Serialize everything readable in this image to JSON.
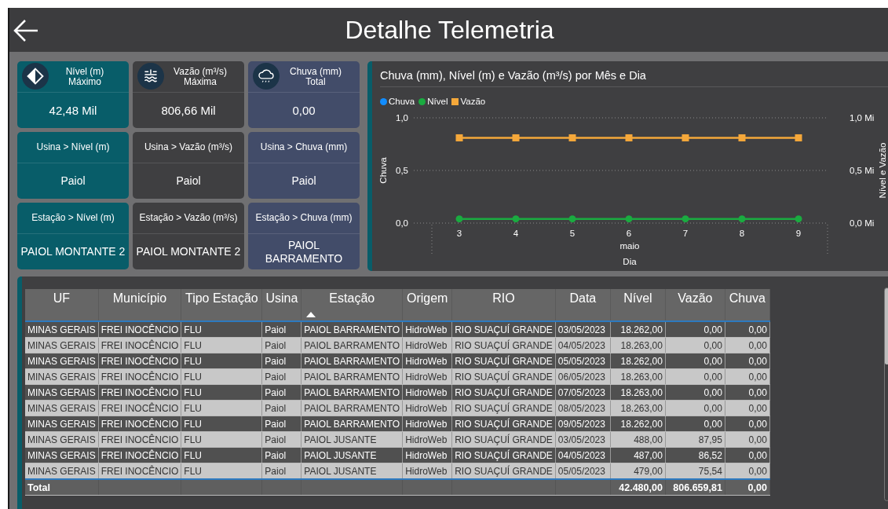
{
  "header": {
    "title": "Detalhe Telemetria"
  },
  "cards": [
    {
      "kind": "metric",
      "title": "Nível (m)",
      "subtitle": "Máximo",
      "value": "42,48 Mil",
      "color": "#085d69"
    },
    {
      "kind": "metric",
      "title": "Vazão (m³/s)",
      "subtitle": "Máxima",
      "value": "806,66 Mil",
      "color": "#3f3f41"
    },
    {
      "kind": "metric",
      "title": "Chuva (mm)",
      "subtitle": "Total",
      "value": "0,00",
      "color": "#424c69"
    },
    {
      "kind": "filter",
      "title": "Usina > Nível (m)",
      "value": "Paiol",
      "color": "#085d69"
    },
    {
      "kind": "filter",
      "title": "Usina > Vazão (m³/s)",
      "value": "Paiol",
      "color": "#3f3f41"
    },
    {
      "kind": "filter",
      "title": "Usina > Chuva (mm)",
      "value": "Paiol",
      "color": "#424c69"
    },
    {
      "kind": "filter",
      "title": "Estação > Nível (m)",
      "value": "PAIOL MONTANTE 2",
      "color": "#085d69"
    },
    {
      "kind": "filter",
      "title": "Estação > Vazão (m³/s)",
      "value": "PAIOL MONTANTE 2",
      "color": "#3f3f41"
    },
    {
      "kind": "filter",
      "title": "Estação > Chuva (mm)",
      "value": "PAIOL BARRAMENTO",
      "color": "#424c69"
    }
  ],
  "chart": {
    "title": "Chuva (mm), Nível (m) e Vazão (m³/s) por Mês e Dia",
    "chart_data": {
      "type": "line",
      "xlabel": "Dia",
      "annotations": [
        {
          "text": "maio"
        }
      ],
      "legend": "top",
      "ylabel": "Chuva",
      "y2label": "Nível e Vazão",
      "categories": [
        "3",
        "4",
        "5",
        "6",
        "7",
        "8",
        "9"
      ],
      "ylim": [
        0,
        1
      ],
      "yticks": [
        {
          "value": 0,
          "label": "0,0"
        },
        {
          "value": 0.5,
          "label": "0,5"
        },
        {
          "value": 1,
          "label": "1,0"
        }
      ],
      "y2lim": [
        0,
        1
      ],
      "y2ticks": [
        {
          "value": 0,
          "label": "0,0 Mi"
        },
        {
          "value": 0.5,
          "label": "0,5 Mi"
        },
        {
          "value": 1,
          "label": "1,0 Mi"
        }
      ],
      "series": [
        {
          "name": "Chuva",
          "color": "#118dff",
          "marker": "circle",
          "values": [
            null,
            null,
            null,
            null,
            null,
            null,
            null
          ]
        },
        {
          "name": "Nível",
          "color": "#1aab40",
          "marker": "circle",
          "values": [
            0.04,
            0.04,
            0.04,
            0.04,
            0.04,
            0.04,
            0.04
          ]
        },
        {
          "name": "Vazão",
          "color": "#f5a83a",
          "marker": "square",
          "values": [
            0.81,
            0.81,
            0.81,
            0.81,
            0.81,
            0.81,
            0.81
          ]
        }
      ]
    }
  },
  "table": {
    "columns": [
      {
        "label": "UF",
        "kind": "text",
        "sorted": false
      },
      {
        "label": "Município",
        "kind": "text",
        "sorted": false
      },
      {
        "label": "Tipo Estação",
        "kind": "text",
        "sorted": false
      },
      {
        "label": "Usina",
        "kind": "text",
        "sorted": false
      },
      {
        "label": "Estação",
        "kind": "text",
        "sorted": true
      },
      {
        "label": "Origem",
        "kind": "text",
        "sorted": false
      },
      {
        "label": "RIO",
        "kind": "text",
        "sorted": false
      },
      {
        "label": "Data",
        "kind": "text",
        "sorted": false
      },
      {
        "label": "Nível",
        "kind": "number",
        "sorted": false
      },
      {
        "label": "Vazão",
        "kind": "number",
        "sorted": false
      },
      {
        "label": "Chuva",
        "kind": "number",
        "sorted": false
      }
    ],
    "rows": [
      [
        "MINAS GERAIS",
        "FREI INOCÊNCIO",
        "FLU",
        "Paiol",
        "PAIOL BARRAMENTO",
        "HidroWeb",
        "RIO SUAÇUÍ GRANDE",
        "03/05/2023",
        "18.262,00",
        "0,00",
        "0,00"
      ],
      [
        "MINAS GERAIS",
        "FREI INOCÊNCIO",
        "FLU",
        "Paiol",
        "PAIOL BARRAMENTO",
        "HidroWeb",
        "RIO SUAÇUÍ GRANDE",
        "04/05/2023",
        "18.263,00",
        "0,00",
        "0,00"
      ],
      [
        "MINAS GERAIS",
        "FREI INOCÊNCIO",
        "FLU",
        "Paiol",
        "PAIOL BARRAMENTO",
        "HidroWeb",
        "RIO SUAÇUÍ GRANDE",
        "05/05/2023",
        "18.262,00",
        "0,00",
        "0,00"
      ],
      [
        "MINAS GERAIS",
        "FREI INOCÊNCIO",
        "FLU",
        "Paiol",
        "PAIOL BARRAMENTO",
        "HidroWeb",
        "RIO SUAÇUÍ GRANDE",
        "06/05/2023",
        "18.263,00",
        "0,00",
        "0,00"
      ],
      [
        "MINAS GERAIS",
        "FREI INOCÊNCIO",
        "FLU",
        "Paiol",
        "PAIOL BARRAMENTO",
        "HidroWeb",
        "RIO SUAÇUÍ GRANDE",
        "07/05/2023",
        "18.263,00",
        "0,00",
        "0,00"
      ],
      [
        "MINAS GERAIS",
        "FREI INOCÊNCIO",
        "FLU",
        "Paiol",
        "PAIOL BARRAMENTO",
        "HidroWeb",
        "RIO SUAÇUÍ GRANDE",
        "08/05/2023",
        "18.263,00",
        "0,00",
        "0,00"
      ],
      [
        "MINAS GERAIS",
        "FREI INOCÊNCIO",
        "FLU",
        "Paiol",
        "PAIOL BARRAMENTO",
        "HidroWeb",
        "RIO SUAÇUÍ GRANDE",
        "09/05/2023",
        "18.262,00",
        "0,00",
        "0,00"
      ],
      [
        "MINAS GERAIS",
        "FREI INOCÊNCIO",
        "FLU",
        "Paiol",
        "PAIOL JUSANTE",
        "HidroWeb",
        "RIO SUAÇUÍ GRANDE",
        "03/05/2023",
        "488,00",
        "87,95",
        "0,00"
      ],
      [
        "MINAS GERAIS",
        "FREI INOCÊNCIO",
        "FLU",
        "Paiol",
        "PAIOL JUSANTE",
        "HidroWeb",
        "RIO SUAÇUÍ GRANDE",
        "04/05/2023",
        "487,00",
        "86,52",
        "0,00"
      ],
      [
        "MINAS GERAIS",
        "FREI INOCÊNCIO",
        "FLU",
        "Paiol",
        "PAIOL JUSANTE",
        "HidroWeb",
        "RIO SUAÇUÍ GRANDE",
        "05/05/2023",
        "479,00",
        "75,54",
        "0,00"
      ]
    ],
    "total": {
      "label": "Total",
      "nivel": "42.480,00",
      "vazao": "806.659,81",
      "chuva": "0,00"
    }
  }
}
